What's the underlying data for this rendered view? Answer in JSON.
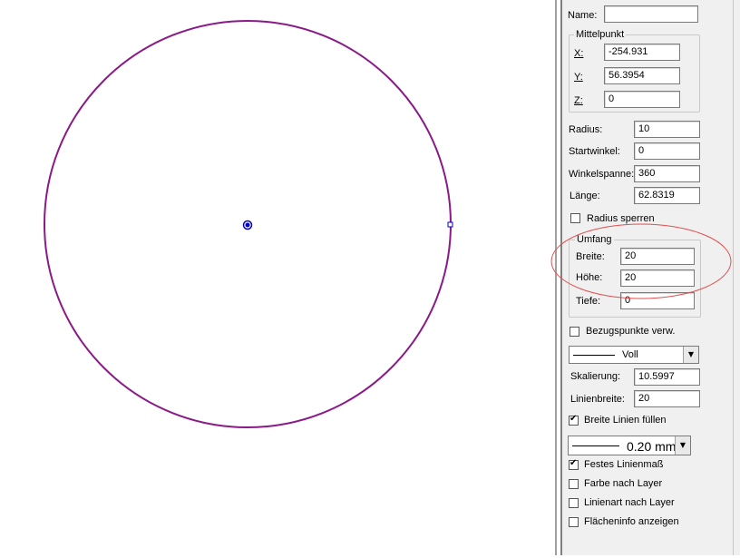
{
  "panel": {
    "name_label": "Name:",
    "name_value": "",
    "mittelpunkt": {
      "legend": "Mittelpunkt",
      "x_label": "X:",
      "x_value": "-254.931",
      "y_label": "Y:",
      "y_value": "56.3954",
      "z_label": "Z:",
      "z_value": "0"
    },
    "radius_label": "Radius:",
    "radius_value": "10",
    "startwinkel_label": "Startwinkel:",
    "startwinkel_value": "0",
    "winkelspanne_label": "Winkelspanne:",
    "winkelspanne_value": "360",
    "laenge_label": "Länge:",
    "laenge_value": "62.8319",
    "radius_sperren": {
      "label": "Radius sperren",
      "checked": false
    },
    "umfang": {
      "legend": "Umfang",
      "breite_label": "Breite:",
      "breite_value": "20",
      "hoehe_label": "Höhe:",
      "hoehe_value": "20",
      "tiefe_label": "Tiefe:",
      "tiefe_value": "0"
    },
    "bezugspunkte": {
      "label": "Bezugspunkte verw.",
      "checked": false
    },
    "linetype_select": "Voll",
    "skalierung_label": "Skalierung:",
    "skalierung_value": "10.5997",
    "linienbreite_label": "Linienbreite:",
    "linienbreite_value": "20",
    "breite_linien_fuellen": {
      "label": "Breite Linien füllen",
      "checked": true
    },
    "lineweight_select": "0.20 mm",
    "festes_linienmass": {
      "label": "Festes Linienmaß",
      "checked": true
    },
    "farbe_nach_layer": {
      "label": "Farbe nach Layer",
      "checked": false
    },
    "linienart_nach_layer": {
      "label": "Linienart nach Layer",
      "checked": false
    },
    "flaecheninfo": {
      "label": "Flächeninfo anzeigen",
      "checked": false
    }
  },
  "colors": {
    "circle_stroke": "#8b1a89",
    "center_point": "#0000cc",
    "highlight_ellipse": "#e05050"
  },
  "icons": {
    "dropdown": "chevron-down-icon",
    "check": "check-icon"
  }
}
